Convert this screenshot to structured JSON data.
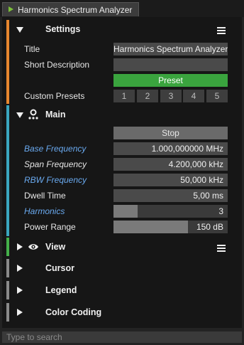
{
  "tab": {
    "title": "Harmonics Spectrum Analyzer"
  },
  "settings": {
    "header": "Settings",
    "title_label": "Title",
    "title_value": "Harmonics Spectrum Analyzer",
    "short_desc_label": "Short Description",
    "short_desc_value": "",
    "preset_label": "Preset",
    "custom_presets_label": "Custom Presets",
    "custom_presets": [
      "1",
      "2",
      "3",
      "4",
      "5"
    ]
  },
  "main": {
    "header": "Main",
    "stop_label": "Stop",
    "base_freq_label": "Base Frequency",
    "base_freq_value": "1.000,000000 MHz",
    "span_freq_label": "Span Frequency",
    "span_freq_value": "4.200,000 kHz",
    "rbw_freq_label": "RBW Frequency",
    "rbw_freq_value": "50,000 kHz",
    "dwell_label": "Dwell Time",
    "dwell_value": "5,00 ms",
    "harmonics_label": "Harmonics",
    "harmonics_value": "3",
    "harmonics_fill_fraction": 0.21,
    "power_label": "Power Range",
    "power_value": "150 dB",
    "power_fill_fraction": 0.65
  },
  "view": {
    "header": "View"
  },
  "cursor": {
    "header": "Cursor"
  },
  "legend": {
    "header": "Legend"
  },
  "color_coding": {
    "header": "Color Coding"
  },
  "search": {
    "placeholder": "Type to search"
  },
  "colors": {
    "settings_accent": "#e8872e",
    "main_accent": "#3aa6bf",
    "view_accent": "#44b04a",
    "collapsed_accent": "#8a8a8a",
    "preset_button": "#3aa43e",
    "link_label": "#6aaaf0"
  },
  "icons": [
    "play-icon",
    "collapse-arrow-icon",
    "expand-arrow-icon",
    "hamburger-menu-icon",
    "main-node-icon",
    "eye-icon"
  ]
}
